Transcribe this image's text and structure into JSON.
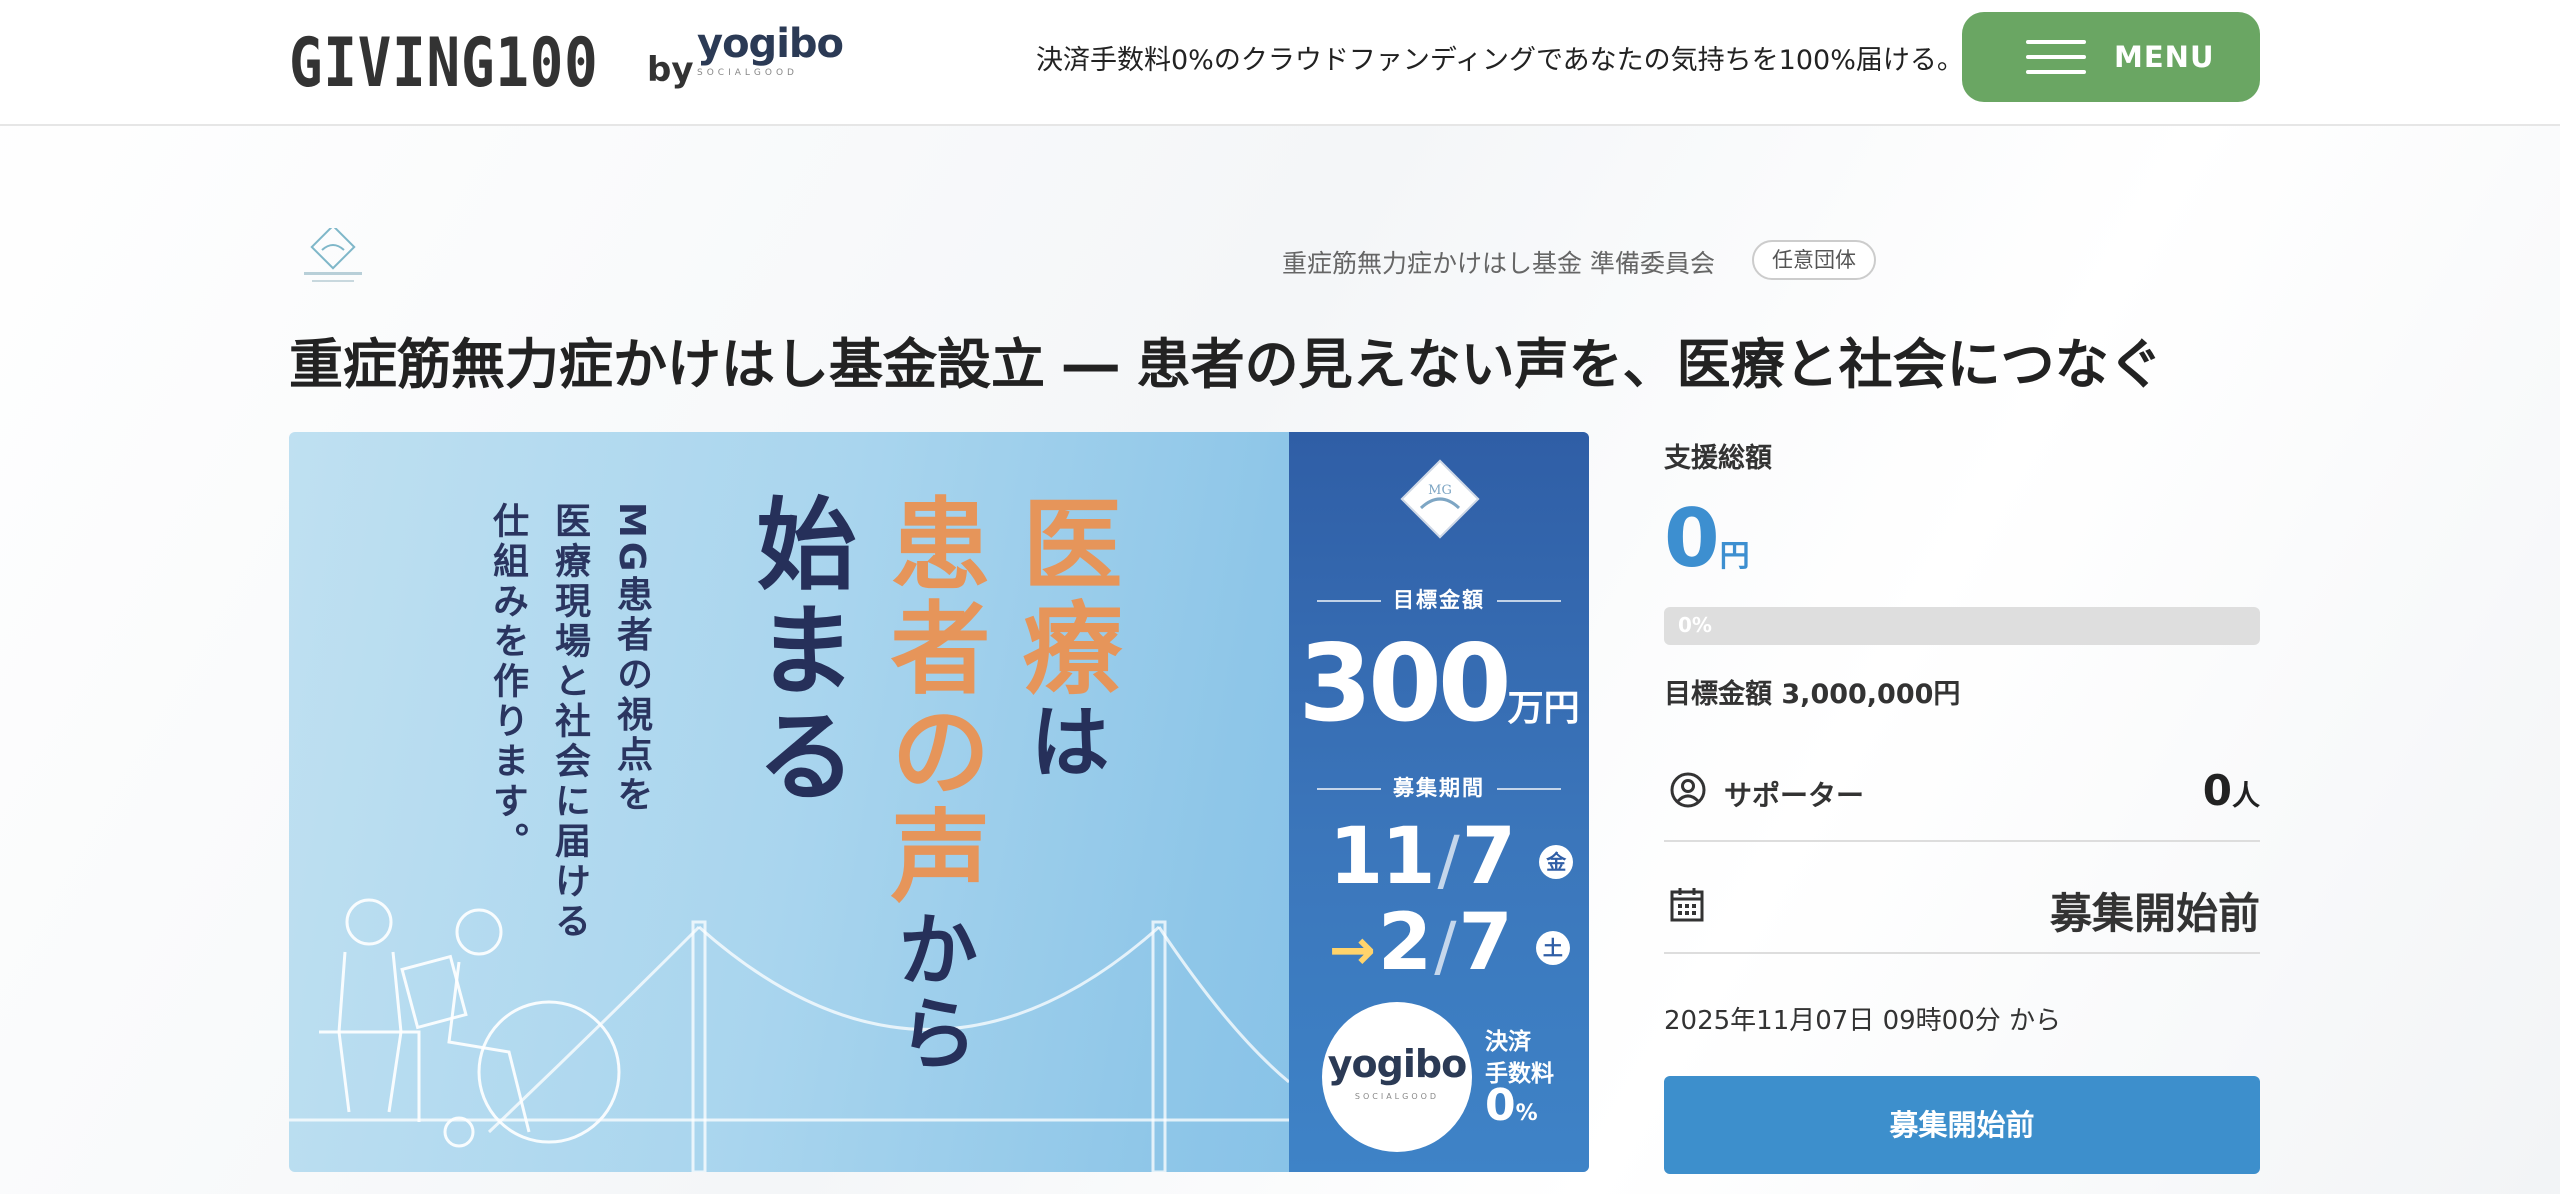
{
  "header": {
    "logo_main": "GIVING100",
    "logo_by": "by",
    "logo_partner": "yogibo",
    "logo_partner_sub": "SOCIALGOOD",
    "tagline": "決済手数料0%のクラウドファンディングであなたの気持ちを100%届ける。",
    "menu_label": "MENU"
  },
  "organization": {
    "name": "重症筋無力症かけはし基金 準備委員会",
    "badge": "任意団体"
  },
  "project": {
    "title": "重症筋無力症かけはし基金設立 ― 患者の見えない声を、医療と社会につなぐ"
  },
  "banner": {
    "copy_lines": [
      "MG患者の視点を",
      "医療現場と社会に届ける",
      "仕組みを作ります。"
    ],
    "headline_start": "始まる",
    "headline_voice_1": "患者の声",
    "headline_voice_2": "から",
    "headline_medical_1": "医療",
    "headline_medical_2": "は",
    "mg_badge": "MG",
    "goal_label": "目標金額",
    "goal_number": "300",
    "goal_unit": "万円",
    "period_label": "募集期間",
    "start_month": "11",
    "start_day": "7",
    "start_dow": "金",
    "end_month": "2",
    "end_day": "7",
    "end_dow": "土",
    "yogibo": "yogibo",
    "yogibo_sub": "SOCIALGOOD",
    "fee_line1": "決済",
    "fee_line2": "手数料",
    "fee_zero": "0",
    "fee_pct": "%"
  },
  "funding": {
    "total_label": "支援総額",
    "total_amount": "0",
    "currency": "円",
    "progress_label": "0%",
    "progress_value": 0,
    "goal_text": "目標金額 3,000,000円",
    "supporters_label": "サポーター",
    "supporters_count": "0",
    "supporters_unit": "人",
    "status_value": "募集開始前",
    "start_datetime": "2025年11月07日 09時00分 から",
    "action_button": "募集開始前"
  },
  "colors": {
    "menu_green": "#6aa663",
    "accent_blue": "#3d8fd0",
    "headline_orange": "#e6955a",
    "navy": "#26305a"
  }
}
